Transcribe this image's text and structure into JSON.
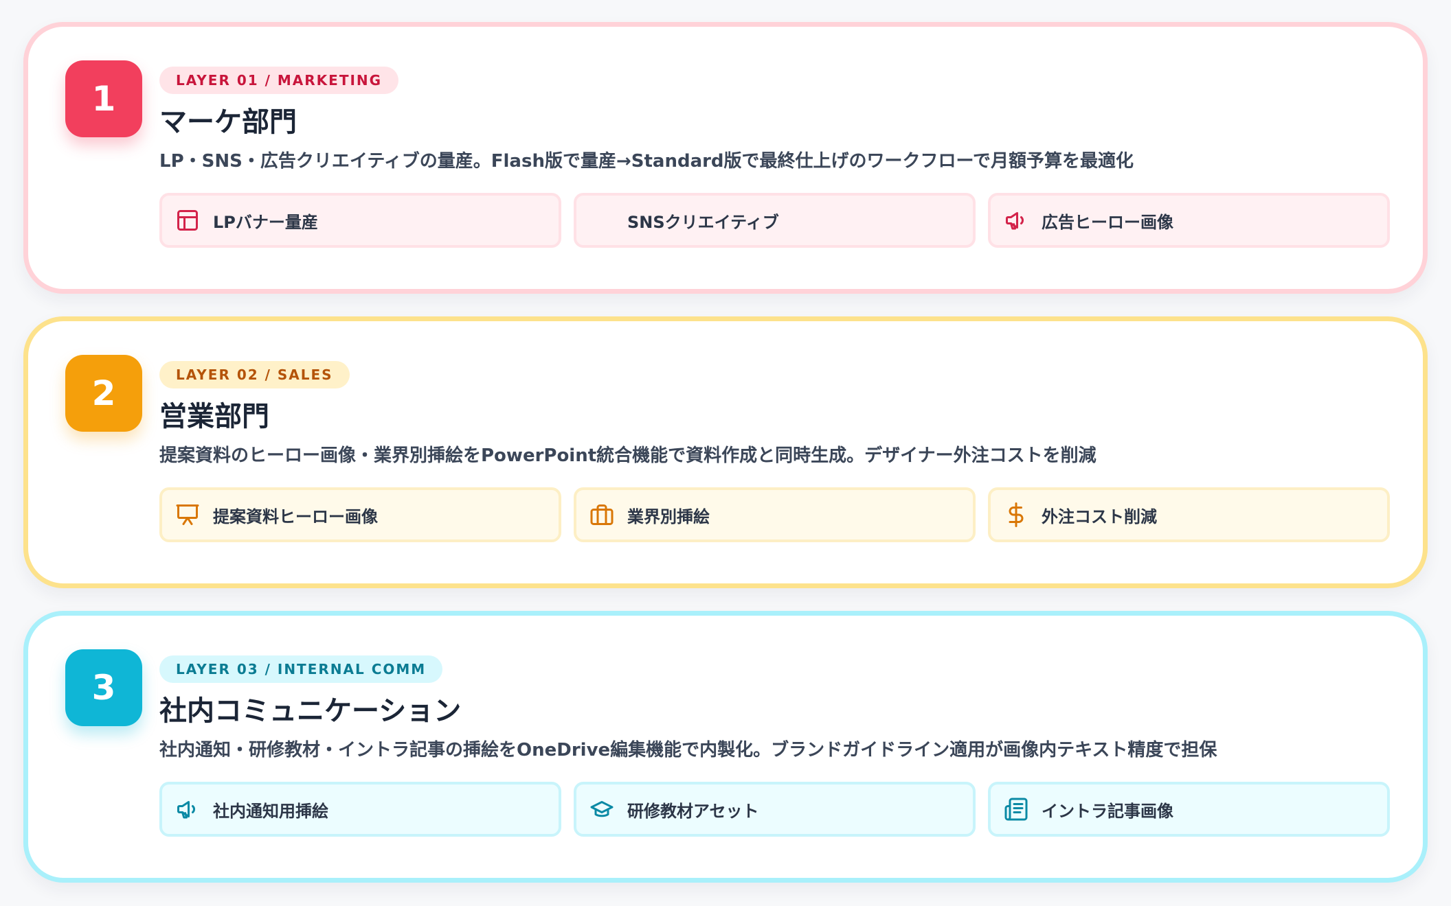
{
  "layers": [
    {
      "number": "1",
      "tag": "LAYER 01 / MARKETING",
      "title": "マーケ部門",
      "description": "LP・SNS・広告クリエイティブの量産。Flash版で量産→Standard版で最終仕上げのワークフローで月額予算を最適化",
      "chips": [
        {
          "label": "LPバナー量産",
          "icon": "layout-icon"
        },
        {
          "label": "SNSクリエイティブ",
          "icon": "none"
        },
        {
          "label": "広告ヒーロー画像",
          "icon": "megaphone-icon"
        }
      ],
      "accent": "#f23f5d"
    },
    {
      "number": "2",
      "tag": "LAYER 02 / SALES",
      "title": "営業部門",
      "description": "提案資料のヒーロー画像・業界別挿絵をPowerPoint統合機能で資料作成と同時生成。デザイナー外注コストを削減",
      "chips": [
        {
          "label": "提案資料ヒーロー画像",
          "icon": "presentation-icon"
        },
        {
          "label": "業界別挿絵",
          "icon": "briefcase-icon"
        },
        {
          "label": "外注コスト削減",
          "icon": "dollar-icon"
        }
      ],
      "accent": "#f59f0b"
    },
    {
      "number": "3",
      "tag": "LAYER 03 / INTERNAL COMM",
      "title": "社内コミュニケーション",
      "description": "社内通知・研修教材・イントラ記事の挿絵をOneDrive編集機能で内製化。ブランドガイドライン適用が画像内テキスト精度で担保",
      "chips": [
        {
          "label": "社内通知用挿絵",
          "icon": "megaphone-icon"
        },
        {
          "label": "研修教材アセット",
          "icon": "graduation-cap-icon"
        },
        {
          "label": "イントラ記事画像",
          "icon": "newspaper-icon"
        }
      ],
      "accent": "#0fb6d6"
    }
  ]
}
